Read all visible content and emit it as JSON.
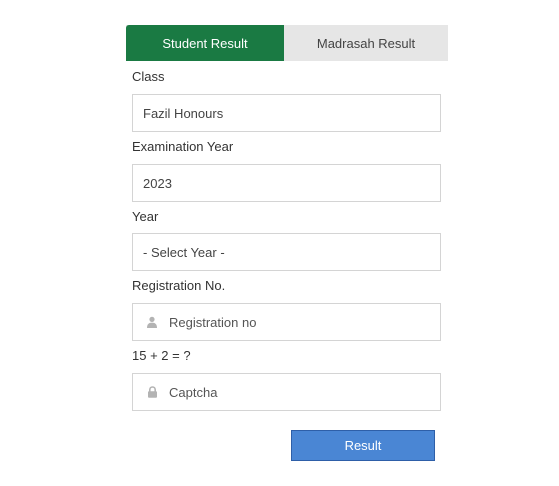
{
  "tabs": {
    "student_label": "Student Result",
    "madrasah_label": "Madrasah Result"
  },
  "form": {
    "class_label": "Class",
    "class_value": "Fazil Honours",
    "exam_year_label": "Examination Year",
    "exam_year_value": "2023",
    "year_label": "Year",
    "year_value": "- Select Year -",
    "registration_label": "Registration No.",
    "registration_placeholder": "Registration no",
    "captcha_label": "15 + 2 = ?",
    "captcha_placeholder": "Captcha",
    "submit_label": "Result"
  },
  "icons": {
    "registration": "user-icon",
    "captcha": "lock-icon"
  },
  "colors": {
    "active_tab": "#1a7a43",
    "inactive_tab": "#e6e6e6",
    "submit_button": "#4a86d4"
  }
}
